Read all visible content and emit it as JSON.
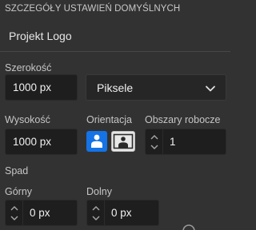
{
  "panel": {
    "section_title": "SZCZEGÓŁY USTAWIEŃ DOMYŚLNYCH",
    "document_name": "Projekt Logo"
  },
  "width": {
    "label": "Szerokość",
    "value": "1000 px"
  },
  "units": {
    "selected": "Piksele"
  },
  "height": {
    "label": "Wysokość",
    "value": "1000 px"
  },
  "orientation": {
    "label": "Orientacja",
    "selected": "portrait"
  },
  "artboards": {
    "label": "Obszary robocze",
    "value": "1"
  },
  "padding": {
    "label": "Spad",
    "top": {
      "label": "Górny",
      "value": "0 px"
    },
    "bottom": {
      "label": "Dolny",
      "value": "0 px"
    }
  },
  "colors": {
    "accent": "#1473e6",
    "panel_bg": "#323232",
    "field_bg": "#1e1e1e"
  }
}
